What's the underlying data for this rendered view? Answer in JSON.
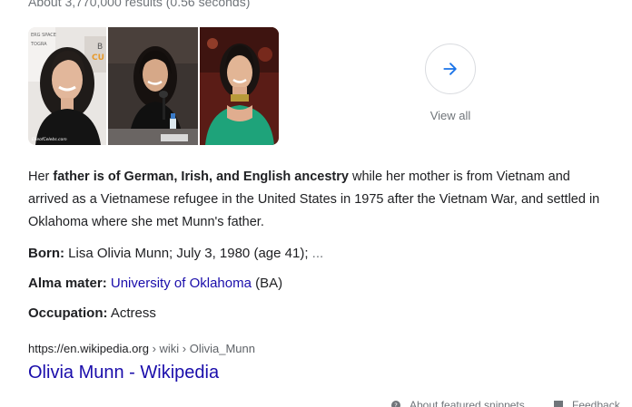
{
  "search": {
    "result_stats": "About 3,770,000 results (0.56 seconds)"
  },
  "images": {
    "view_all_label": "View all",
    "thumbnail_watermark": "ElleofCelebs.com"
  },
  "snippet": {
    "text_before": "Her ",
    "bold": "father is of German, Irish, and English ancestry",
    "text_after": " while her mother is from Vietnam and arrived as a Vietnamese refugee in the United States in 1975 after the Vietnam War, and settled in Oklahoma where she met Munn's father."
  },
  "facts": {
    "born": {
      "label": "Born:",
      "value": "Lisa Olivia Munn; July 3, 1980 (age 41);",
      "more": "..."
    },
    "alma_mater": {
      "label": "Alma mater:",
      "link": "University of Oklahoma",
      "degree": "(BA)"
    },
    "occupation": {
      "label": "Occupation:",
      "value": "Actress"
    }
  },
  "result": {
    "cite_url": "https://en.wikipedia.org",
    "cite_path": " › wiki › Olivia_Munn",
    "title": "Olivia Munn - Wikipedia"
  },
  "footer": {
    "about_label": "About featured snippets",
    "feedback_label": "Feedback"
  },
  "colors": {
    "link": "#1a0dab",
    "text": "#202124",
    "muted": "#70757a",
    "accent_arrow": "#1a73e8"
  },
  "icons": {
    "view_all": "arrow-right-icon",
    "about": "help-circle-icon",
    "feedback": "feedback-flag-icon"
  }
}
